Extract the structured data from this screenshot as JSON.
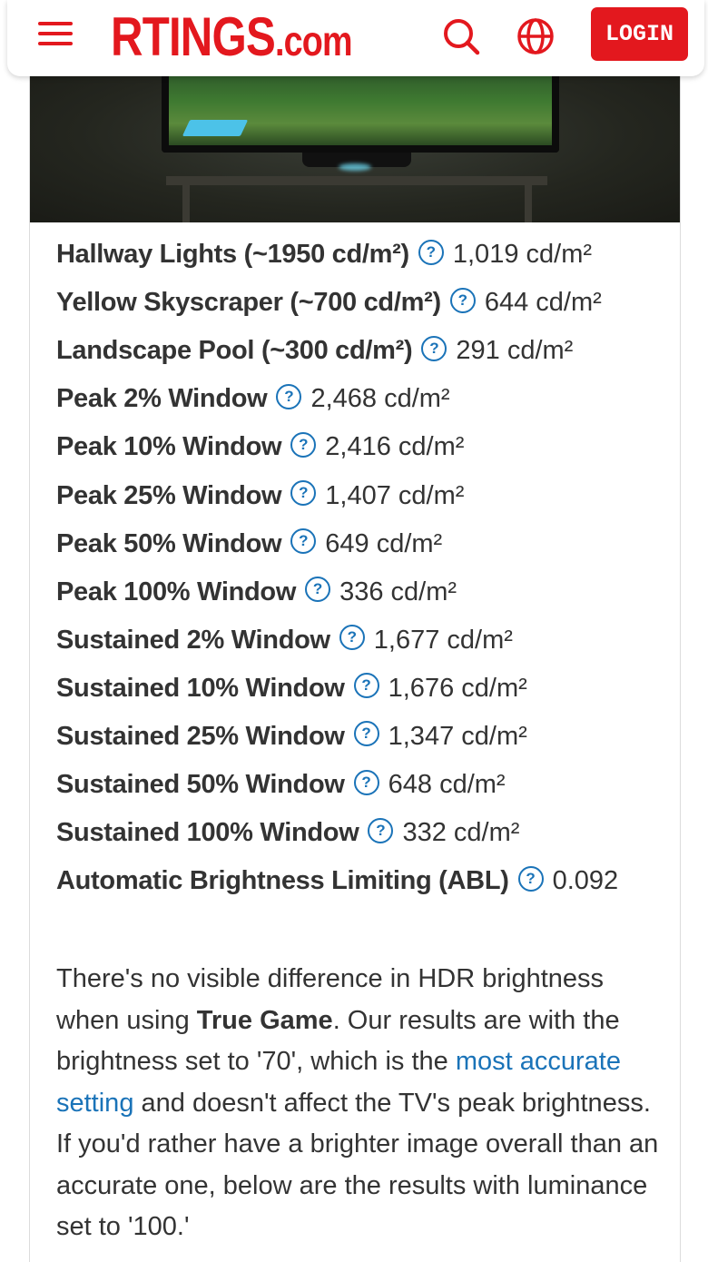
{
  "header": {
    "logo_main": "RTINGS",
    "logo_suffix": ".com",
    "login_label": "LOGIN",
    "brand_color": "#e3181e"
  },
  "results": [
    {
      "label": "Hallway Lights (~1950 cd/m²)",
      "value": "1,019 cd/m²"
    },
    {
      "label": "Yellow Skyscraper (~700 cd/m²)",
      "value": "644 cd/m²"
    },
    {
      "label": "Landscape Pool (~300 cd/m²)",
      "value": "291 cd/m²"
    },
    {
      "label": "Peak 2% Window",
      "value": "2,468 cd/m²"
    },
    {
      "label": "Peak 10% Window",
      "value": "2,416 cd/m²"
    },
    {
      "label": "Peak 25% Window",
      "value": "1,407 cd/m²"
    },
    {
      "label": "Peak 50% Window",
      "value": "649 cd/m²"
    },
    {
      "label": "Peak 100% Window",
      "value": "336 cd/m²"
    },
    {
      "label": "Sustained 2% Window",
      "value": "1,677 cd/m²"
    },
    {
      "label": "Sustained 10% Window",
      "value": "1,676 cd/m²"
    },
    {
      "label": "Sustained 25% Window",
      "value": "1,347 cd/m²"
    },
    {
      "label": "Sustained 50% Window",
      "value": "648 cd/m²"
    },
    {
      "label": "Sustained 100% Window",
      "value": "332 cd/m²"
    },
    {
      "label": "Automatic Brightness Limiting (ABL)",
      "value": "0.092"
    }
  ],
  "help_glyph": "?",
  "paragraph": {
    "part1": "There's no visible difference in HDR brightness when using ",
    "bold": "True Game",
    "part2": ". Our results are with the brightness set to '70', which is the ",
    "link": "most accurate setting",
    "part3": " and doesn't affect the TV's peak brightness. If you'd rather have a brighter image overall than an accurate one, below are the results with luminance set to '100.'"
  },
  "colors": {
    "link": "#1a73b8",
    "text": "#333333"
  }
}
